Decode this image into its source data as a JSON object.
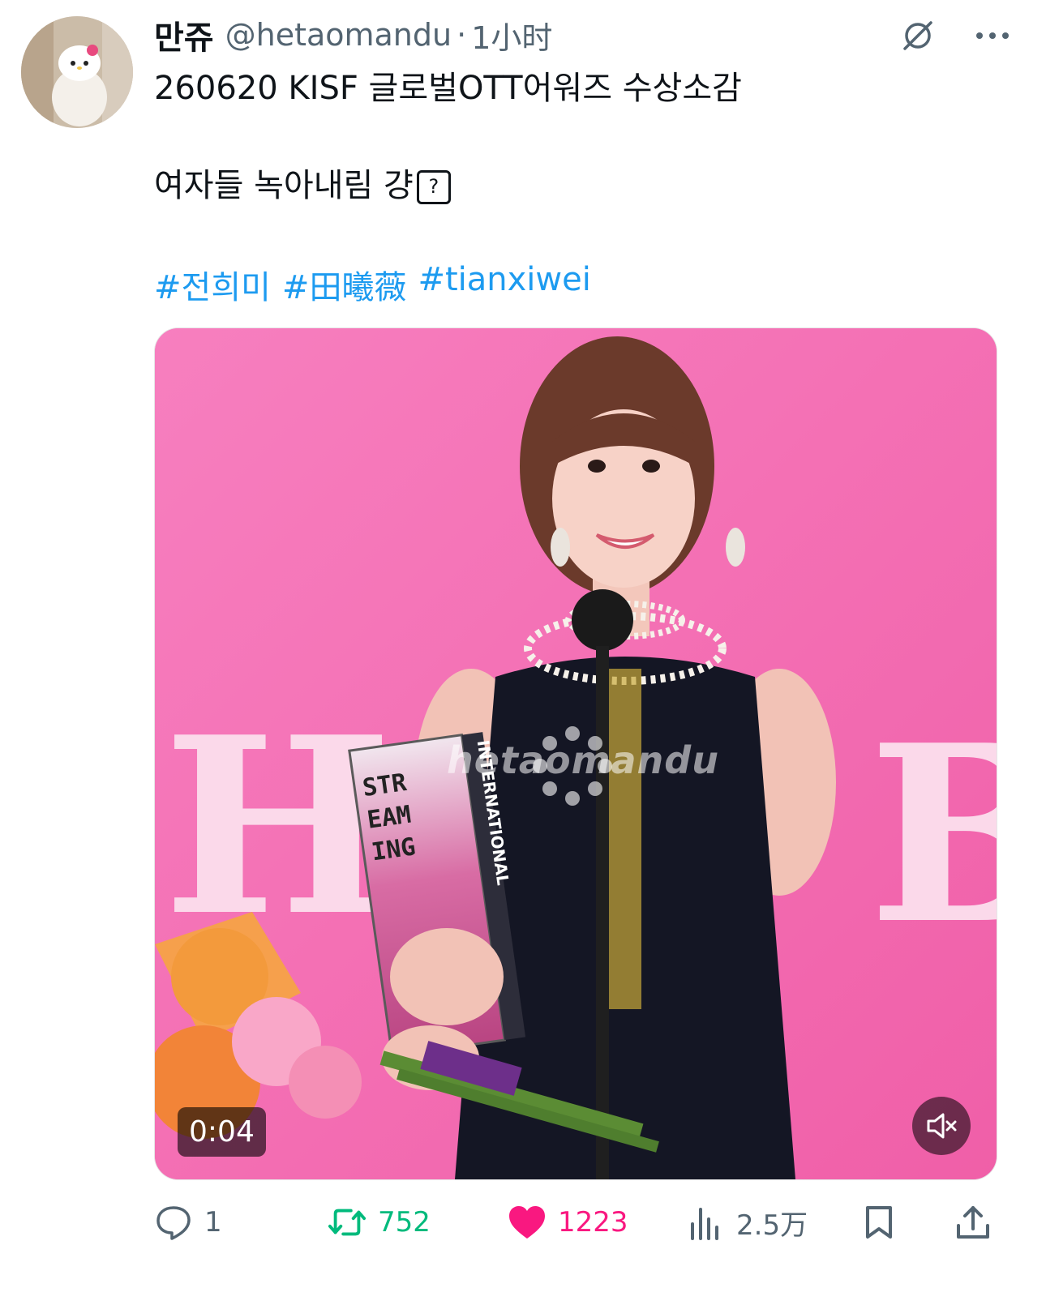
{
  "tweet": {
    "display_name": "만쥬",
    "handle": "@hetaomandu",
    "separator": "·",
    "time": "1小时",
    "line1": "260620 KISF 글로벌OTT어워즈 수상소감",
    "line2": "여자들 녹아내림 걍",
    "unknown_glyph": "?",
    "hashtags": [
      "#전희미",
      "#田曦薇",
      "#tianxiwei"
    ]
  },
  "media": {
    "duration": "0:04",
    "watermark": "hetaomandu",
    "trophy_text": [
      "STR",
      "EAM",
      "ING"
    ],
    "trophy_side_text": "INTERNATIONAL"
  },
  "actions": {
    "replies": "1",
    "reposts": "752",
    "likes": "1223",
    "views": "2.5万"
  },
  "colors": {
    "accent": "#1d9bf0",
    "repost": "#00ba7c",
    "like": "#f91880",
    "muted": "#536471"
  },
  "icons": [
    "grok-icon",
    "more-icon",
    "reply-icon",
    "repost-icon",
    "like-icon",
    "views-icon",
    "bookmark-icon",
    "share-icon",
    "mute-icon"
  ]
}
